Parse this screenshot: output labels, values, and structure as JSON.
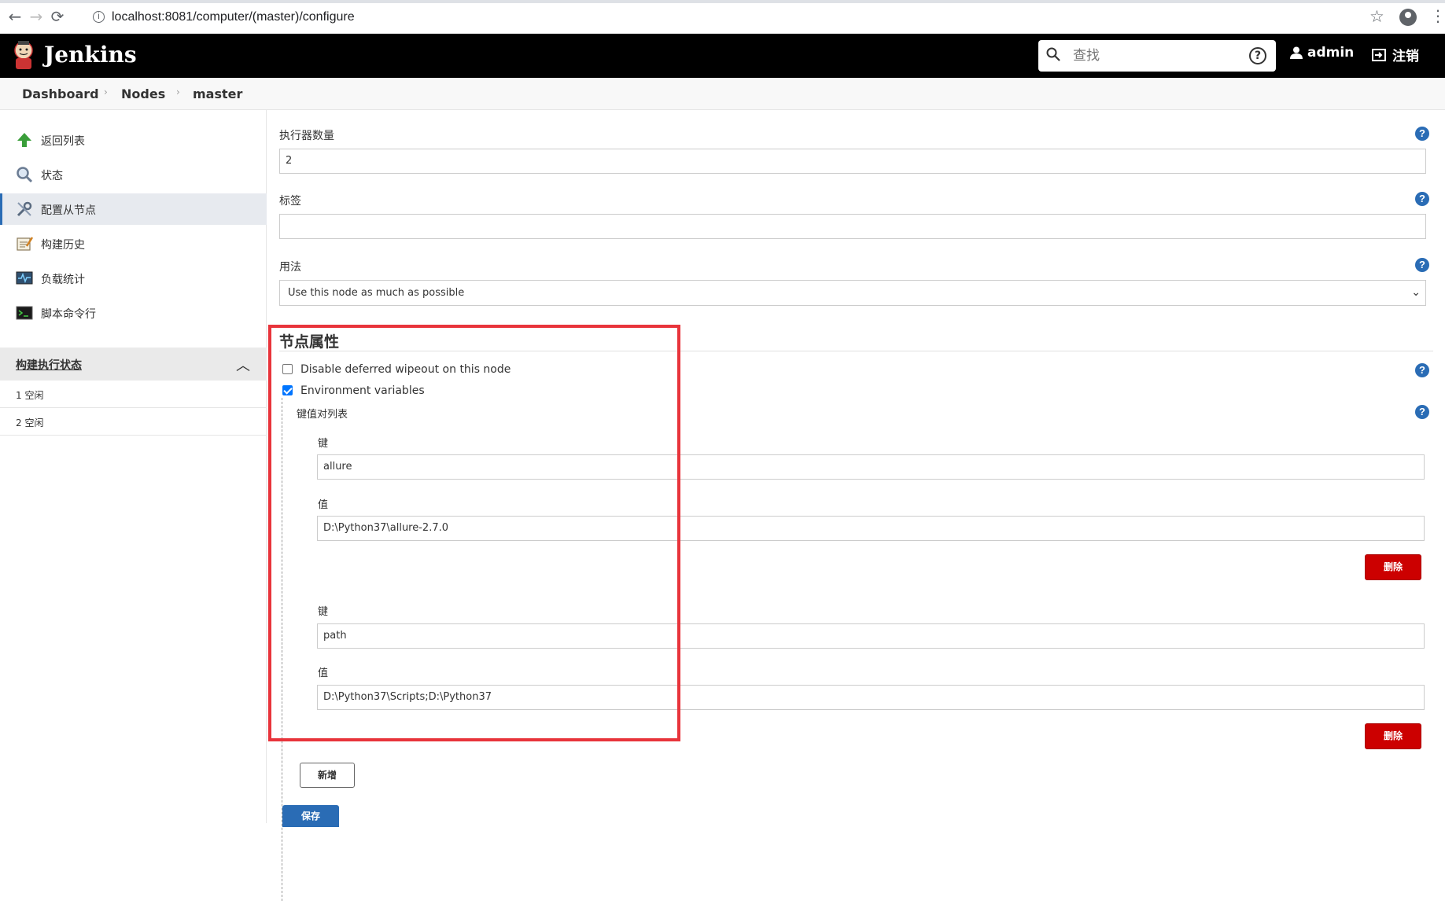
{
  "browser": {
    "url": "localhost:8081/computer/(master)/configure",
    "back_icon": "←",
    "forward_icon": "→",
    "reload_icon": "⟳",
    "info_icon": "i",
    "star_icon": "☆",
    "menu_icon": "⋮"
  },
  "header": {
    "brand": "Jenkins",
    "search_placeholder": "查找",
    "help_icon": "?",
    "user": "admin",
    "logout": "注销"
  },
  "breadcrumb": {
    "items": [
      "Dashboard",
      "Nodes",
      "master"
    ],
    "sep": "›"
  },
  "sidebar": {
    "items": [
      {
        "label": "返回列表",
        "icon": "up-arrow-icon"
      },
      {
        "label": "状态",
        "icon": "magnifier-icon"
      },
      {
        "label": "配置从节点",
        "icon": "wrench-icon"
      },
      {
        "label": "构建历史",
        "icon": "notepad-icon"
      },
      {
        "label": "负载统计",
        "icon": "monitor-icon"
      },
      {
        "label": "脚本命令行",
        "icon": "terminal-icon"
      }
    ],
    "executor_status": {
      "title": "构建执行状态",
      "chevron": "︿",
      "rows": [
        "1  空闲",
        "2  空闲"
      ]
    }
  },
  "form": {
    "executors": {
      "label": "执行器数量",
      "value": "2"
    },
    "labels": {
      "label": "标签",
      "value": ""
    },
    "usage": {
      "label": "用法",
      "value": "Use this node as much as possible",
      "arrow": "⌄"
    },
    "node_properties": {
      "title": "节点属性",
      "disable_wipeout": {
        "label": "Disable deferred wipeout on this node",
        "checked": false
      },
      "env_vars": {
        "label": "Environment variables",
        "checked": true
      },
      "kv_list_label": "键值对列表",
      "key_label": "键",
      "value_label": "值",
      "entries": [
        {
          "key": "allure",
          "value": "D:\\Python37\\allure-2.7.0"
        },
        {
          "key": "path",
          "value": "D:\\Python37\\Scripts;D:\\Python37"
        }
      ],
      "delete_label": "删除",
      "add_label": "新增"
    },
    "save_label": "保存",
    "help_q": "?"
  },
  "colors": {
    "accent": "#2a6cb5",
    "danger": "#cc0000",
    "highlight_box": "#e8343b"
  }
}
